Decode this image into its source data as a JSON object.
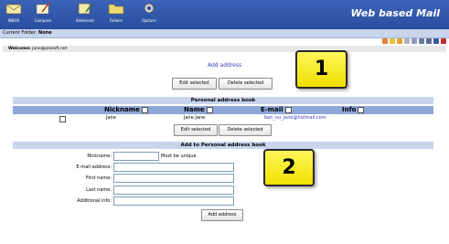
{
  "nav": {
    "items": [
      {
        "label": "INBOX",
        "icon": "inbox-icon"
      },
      {
        "label": "Compose",
        "icon": "compose-icon"
      },
      {
        "label": "Addresses",
        "icon": "addresses-icon"
      },
      {
        "label": "Folders",
        "icon": "folders-icon"
      },
      {
        "label": "Options",
        "icon": "options-icon"
      }
    ],
    "brand": "Web based Mail"
  },
  "folderbar": {
    "label": "Current Folder:",
    "value": "None"
  },
  "welcome": {
    "label": "Welcome:",
    "value": "jane@piezoft.net"
  },
  "top": {
    "add_link": "Add address",
    "edit_btn": "Edit selected",
    "delete_btn": "Delete selected"
  },
  "book": {
    "title": "Personal address book",
    "columns": [
      "Nickname",
      "Name",
      "E-mail",
      "Info"
    ],
    "rows": [
      {
        "nickname": "Jane",
        "name": "Jane Jane",
        "email": "ban_nu_jane@hotmail.com",
        "info": ""
      }
    ],
    "edit_btn": "Edit selected",
    "delete_btn": "Delete selected"
  },
  "addform": {
    "title": "Add to Personal address book",
    "nickname_label": "Nickname:",
    "nickname_hint": "Must be unique",
    "email_label": "E-mail address:",
    "first_label": "First name:",
    "last_label": "Last name:",
    "info_label": "Additional info:",
    "submit": "Add address"
  },
  "callouts": {
    "one": "1",
    "two": "2"
  },
  "colors": {
    "topbar": "#2a4e9e",
    "section": "#c8d5ec",
    "column_header": "#8ea7d8",
    "callout": "#f5e600"
  }
}
